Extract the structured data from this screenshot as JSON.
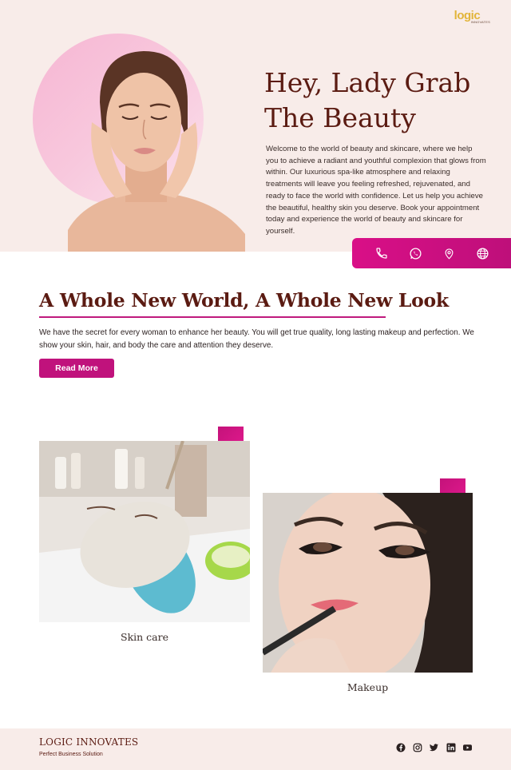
{
  "brand_logo": {
    "word": "logic",
    "sub": "INNOVATES"
  },
  "hero": {
    "title_line1": "Hey, Lady Grab",
    "title_line2": "The Beauty",
    "body": "Welcome to the world of beauty and skincare, where we help you to achieve a radiant and youthful complexion that glows from within. Our luxurious spa-like atmosphere and relaxing treatments will leave you feeling refreshed, rejuvenated, and ready to face the world with confidence. Let us help you achieve the beautiful, healthy skin you deserve. Book your appointment today and experience the world of beauty and skincare for yourself."
  },
  "contact_icons": [
    "phone-icon",
    "whatsapp-icon",
    "location-pin-icon",
    "globe-icon"
  ],
  "intro": {
    "title": "A Whole New World, A Whole New Look",
    "body": "We have the secret for every woman to enhance her beauty. You will get true quality, long lasting makeup and perfection. We show your skin, hair, and body the care and attention they deserve.",
    "button_label": "Read More"
  },
  "services": [
    {
      "caption": "Skin care"
    },
    {
      "caption": "Makeup"
    }
  ],
  "footer": {
    "brand": "LOGIC INNOVATES",
    "tagline": "Perfect Business Solution",
    "social_icons": [
      "facebook-icon",
      "instagram-icon",
      "twitter-icon",
      "linkedin-icon",
      "youtube-icon"
    ]
  },
  "colors": {
    "accent": "#c0127c",
    "heading": "#5b1b12",
    "hero_bg": "#f8ece9",
    "logo": "#e2b53a"
  }
}
